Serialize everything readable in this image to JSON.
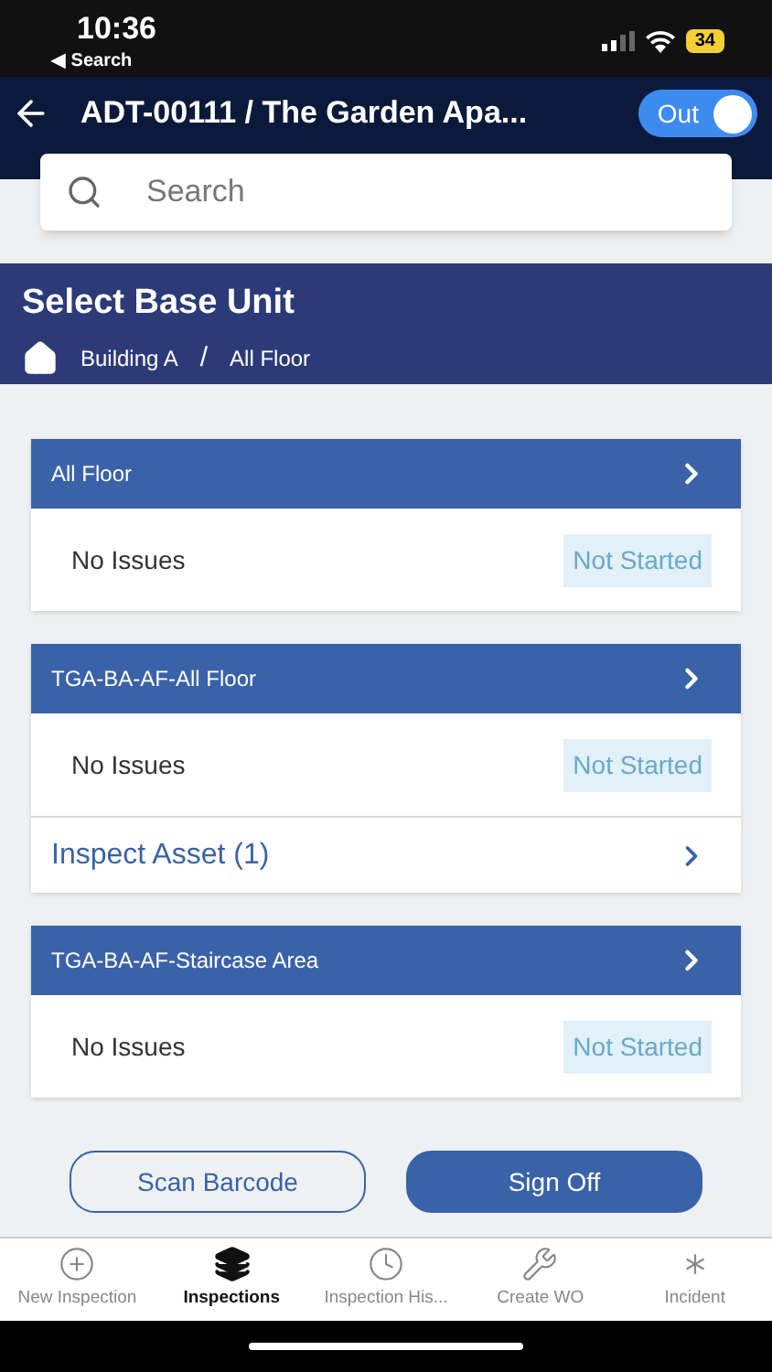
{
  "status_bar": {
    "time": "10:36",
    "back_label": "◀ Search",
    "battery": "34"
  },
  "header": {
    "title": "ADT-00111 / The Garden Apa...",
    "toggle": {
      "label": "Out",
      "on": true
    }
  },
  "search": {
    "placeholder": "Search"
  },
  "banner": {
    "title": "Select Base Unit",
    "breadcrumb": [
      "Building A",
      "All Floor"
    ],
    "separator": "/"
  },
  "units": [
    {
      "name": "All Floor",
      "issues": "No Issues",
      "status": "Not Started"
    },
    {
      "name": "TGA-BA-AF-All Floor",
      "issues": "No Issues",
      "status": "Not Started",
      "asset_link": "Inspect Asset (1)"
    },
    {
      "name": "TGA-BA-AF-Staircase Area",
      "issues": "No Issues",
      "status": "Not Started"
    }
  ],
  "actions": [
    {
      "label": "Scan Barcode",
      "kind": "outline"
    },
    {
      "label": "Sign Off",
      "kind": "filled"
    }
  ],
  "tabs": [
    {
      "label": "New Inspection",
      "selected": false
    },
    {
      "label": "Inspections",
      "selected": true
    },
    {
      "label": "Inspection His...",
      "selected": false
    },
    {
      "label": "Create WO",
      "selected": false
    },
    {
      "label": "Incident",
      "selected": false
    }
  ]
}
